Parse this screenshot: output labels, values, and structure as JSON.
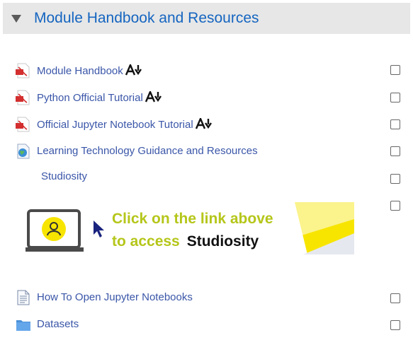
{
  "section": {
    "title": "Module Handbook and Resources"
  },
  "items": [
    {
      "label": "Module Handbook",
      "icon": "pdf-icon",
      "accessibility": true
    },
    {
      "label": "Python Official Tutorial",
      "icon": "pdf-icon",
      "accessibility": true
    },
    {
      "label": "Official Jupyter Notebook Tutorial",
      "icon": "pdf-icon",
      "accessibility": true
    },
    {
      "label": "Learning Technology Guidance and Resources",
      "icon": "url-globe-icon",
      "accessibility": false
    },
    {
      "label": "Studiosity",
      "icon": "",
      "accessibility": false
    },
    {
      "label": "How To Open Jupyter Notebooks",
      "icon": "page-icon",
      "accessibility": false
    },
    {
      "label": "Datasets",
      "icon": "folder-icon",
      "accessibility": false
    }
  ],
  "banner": {
    "line1": "Click on the link above",
    "line2": "to access",
    "brand": "Studiosity"
  },
  "colors": {
    "header_bg": "#e7e7e7",
    "title": "#1565c0",
    "link": "#3a56a8",
    "banner_text": "#b5c61a",
    "banner_yellow": "#f7e500"
  }
}
